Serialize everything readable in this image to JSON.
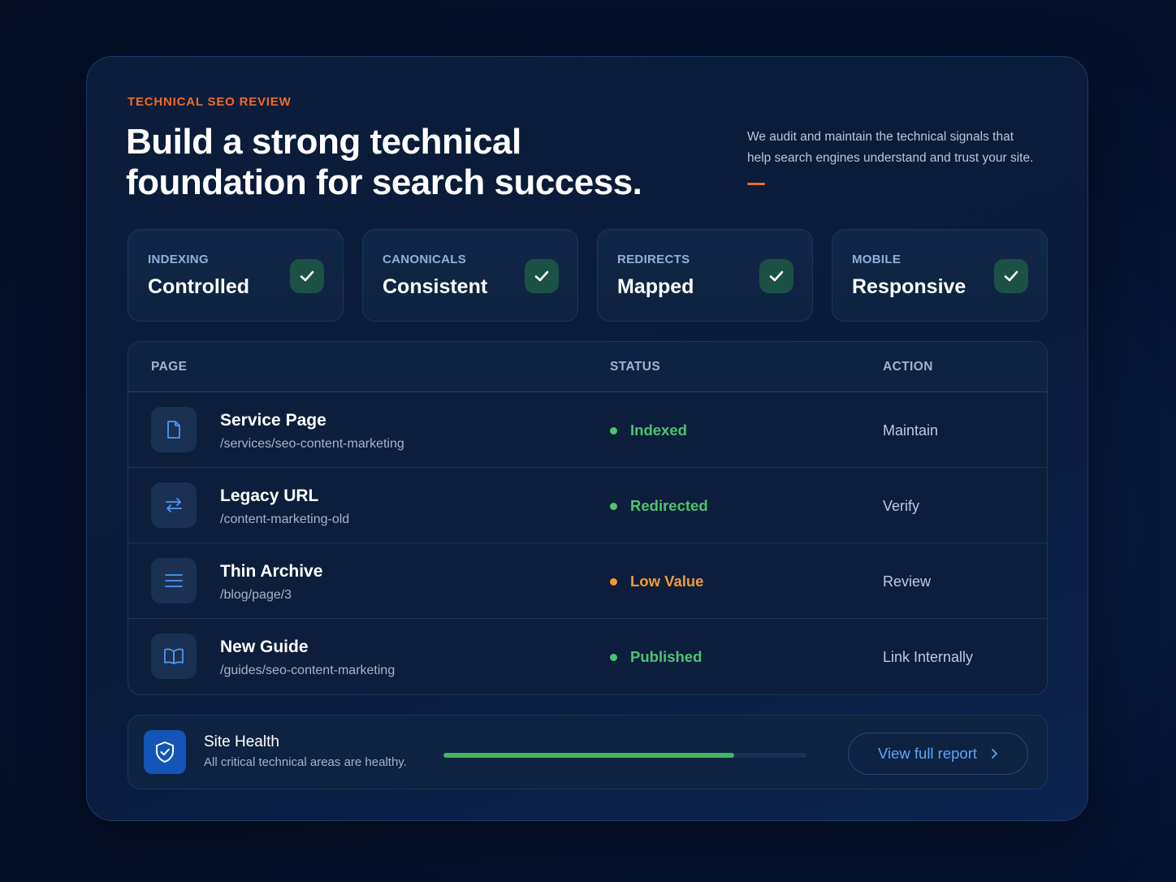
{
  "header": {
    "eyebrow": "TECHNICAL SEO REVIEW",
    "headline_line1": "Build a strong technical",
    "headline_line2": "foundation for search success.",
    "intro_line1": "We audit and maintain the technical signals that",
    "intro_line2": "help search engines understand and trust your site."
  },
  "metrics": [
    {
      "label": "INDEXING",
      "value": "Controlled",
      "icon": "check-icon"
    },
    {
      "label": "CANONICALS",
      "value": "Consistent",
      "icon": "check-icon"
    },
    {
      "label": "REDIRECTS",
      "value": "Mapped",
      "icon": "check-icon"
    },
    {
      "label": "MOBILE",
      "value": "Responsive",
      "icon": "check-icon"
    }
  ],
  "table": {
    "columns": [
      "PAGE",
      "STATUS",
      "ACTION"
    ],
    "rows": [
      {
        "icon": "document-icon",
        "title": "Service Page",
        "path": "/services/seo-content-marketing",
        "status": "Indexed",
        "status_color": "#4cc46e",
        "action": "Maintain"
      },
      {
        "icon": "redirect-arrows-icon",
        "title": "Legacy URL",
        "path": "/content-marketing-old",
        "status": "Redirected",
        "status_color": "#4cc46e",
        "action": "Verify"
      },
      {
        "icon": "list-lines-icon",
        "title": "Thin Archive",
        "path": "/blog/page/3",
        "status": "Low Value",
        "status_color": "#f29a38",
        "action": "Review"
      },
      {
        "icon": "open-book-icon",
        "title": "New Guide",
        "path": "/guides/seo-content-marketing",
        "status": "Published",
        "status_color": "#4cc46e",
        "action": "Link Internally"
      }
    ]
  },
  "health": {
    "icon": "shield-check-icon",
    "title": "Site Health",
    "subtitle": "All critical technical areas are healthy.",
    "progress": 0.8,
    "button_label": "View full report",
    "button_icon": "chevron-right-icon"
  },
  "colors": {
    "accent_orange": "#f06a2a",
    "success_green": "#4cc46e",
    "warning_orange": "#f29a38",
    "link_blue": "#5fa5f6"
  }
}
